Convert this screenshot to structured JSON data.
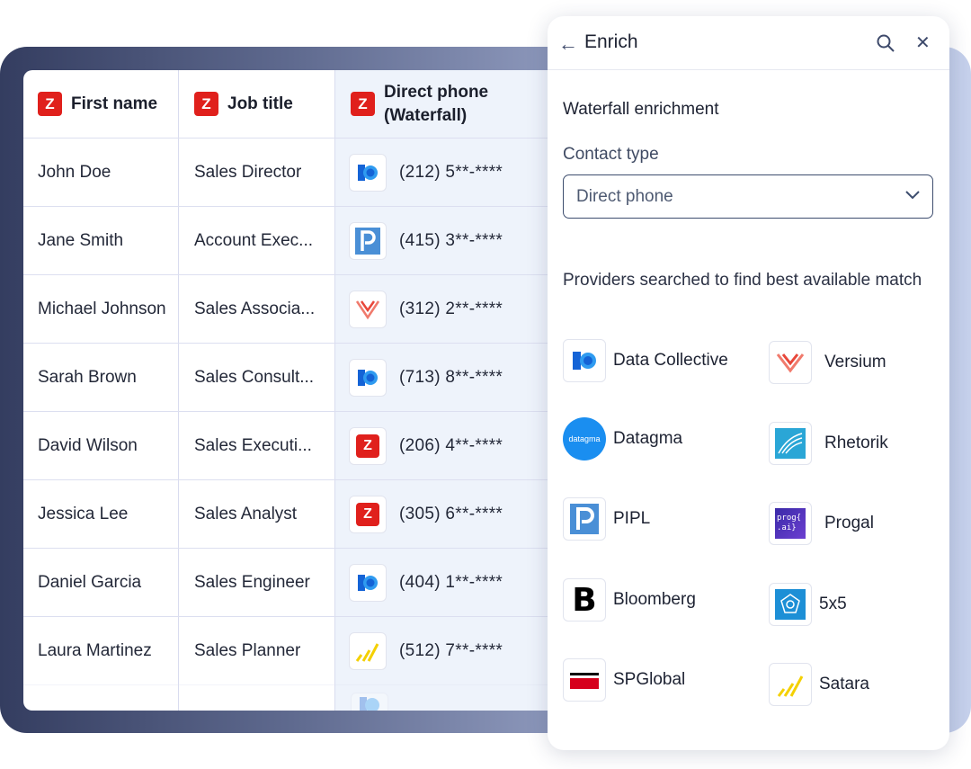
{
  "table": {
    "headers": {
      "first_name": "First name",
      "job_title": "Job title",
      "direct_phone_line1": "Direct phone",
      "direct_phone_line2": "(Waterfall)"
    },
    "rows": [
      {
        "first_name": "John Doe",
        "job_title": "Sales Director",
        "phone": "(212) 5**-****",
        "provider_icon": "data-collective-icon"
      },
      {
        "first_name": "Jane Smith",
        "job_title": "Account Exec...",
        "phone": "(415) 3**-****",
        "provider_icon": "pipl-icon"
      },
      {
        "first_name": "Michael Johnson",
        "job_title": "Sales Associa...",
        "phone": "(312) 2**-****",
        "provider_icon": "versium-icon"
      },
      {
        "first_name": "Sarah Brown",
        "job_title": "Sales Consult...",
        "phone": "(713) 8**-****",
        "provider_icon": "data-collective-icon"
      },
      {
        "first_name": "David Wilson",
        "job_title": "Sales Executi...",
        "phone": "(206) 4**-****",
        "provider_icon": "zoominfo-icon"
      },
      {
        "first_name": "Jessica Lee",
        "job_title": "Sales Analyst",
        "phone": "(305) 6**-****",
        "provider_icon": "zoominfo-icon"
      },
      {
        "first_name": "Daniel Garcia",
        "job_title": "Sales Engineer",
        "phone": "(404) 1**-****",
        "provider_icon": "data-collective-icon"
      },
      {
        "first_name": "Laura Martinez",
        "job_title": "Sales Planner",
        "phone": "(512) 7**-****",
        "provider_icon": "satara-icon"
      }
    ]
  },
  "panel": {
    "title": "Enrich",
    "section_title": "Waterfall enrichment",
    "contact_type_label": "Contact type",
    "contact_type_value": "Direct phone",
    "providers_note": "Providers searched to find best available match",
    "providers": [
      {
        "name": "Data Collective",
        "icon": "data-collective-icon"
      },
      {
        "name": "Versium",
        "icon": "versium-icon"
      },
      {
        "name": "Datagma",
        "icon": "datagma-icon",
        "icon_text": "datagma"
      },
      {
        "name": "Rhetorik",
        "icon": "rhetorik-icon"
      },
      {
        "name": "PIPL",
        "icon": "pipl-icon"
      },
      {
        "name": "Progal",
        "icon": "progal-icon",
        "icon_text_1": "prog{",
        "icon_text_2": ".ai}"
      },
      {
        "name": "Bloomberg",
        "icon": "bloomberg-icon"
      },
      {
        "name": "5x5",
        "icon": "five-by-five-icon"
      },
      {
        "name": "SPGlobal",
        "icon": "spglobal-icon"
      },
      {
        "name": "Satara",
        "icon": "satara-icon"
      }
    ]
  },
  "colors": {
    "accent_red": "#e0201c",
    "datagma_blue": "#1a8ef0",
    "border": "#3d4d6e"
  }
}
